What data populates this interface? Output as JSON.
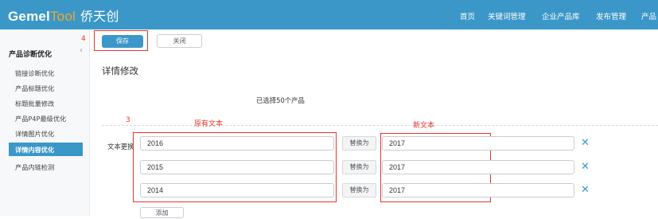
{
  "header": {
    "logo_brand": "Gemel",
    "logo_tool": "Tool",
    "logo_cn": "侨天创",
    "nav": [
      "首页",
      "关键词管理",
      "企业产品库",
      "发布管理",
      "产品"
    ]
  },
  "sidebar": {
    "title": "产品诊断优化",
    "collapse_icon": "‹",
    "items": [
      "链接诊断优化",
      "产品标题优化",
      "标题批量修改",
      "产品P4P最级优化",
      "详情图片优化",
      "详情内容优化",
      "产品内链检测"
    ],
    "active_item": "详情内容优化"
  },
  "toolbar": {
    "save": "保存",
    "close": "关闭"
  },
  "main": {
    "heading": "详情修改",
    "selected_info": "已选择50个产品",
    "replace_label": "文本更换",
    "replace_to_label": "替换为",
    "add_button": "添加",
    "rows": [
      {
        "original": "2016",
        "new": "2017"
      },
      {
        "original": "2015",
        "new": "2017"
      },
      {
        "original": "2014",
        "new": "2017"
      }
    ]
  },
  "annotations": {
    "num4": "4",
    "num3": "3",
    "original_text": "原有文本",
    "new_text": "新文本"
  },
  "colors": {
    "primary": "#3b97c8",
    "annotation_red": "#e8352a"
  },
  "icons": {
    "remove": "close-icon"
  }
}
